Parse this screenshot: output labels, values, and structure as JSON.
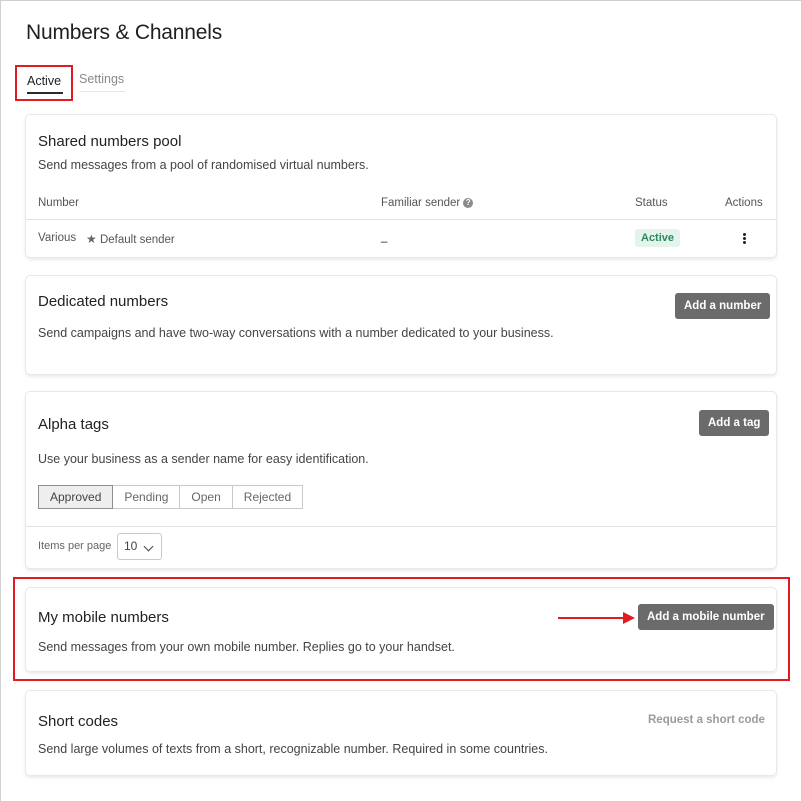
{
  "page": {
    "title": "Numbers & Channels"
  },
  "tabs": [
    {
      "label": "Active",
      "active": true
    },
    {
      "label": "Settings",
      "active": false
    }
  ],
  "shared_pool": {
    "title": "Shared numbers pool",
    "description": "Send messages from a pool of randomised virtual numbers.",
    "columns": [
      "Number",
      "Familiar sender",
      "Status",
      "Actions"
    ],
    "row": {
      "number": "Various",
      "default_sender": "Default sender",
      "familiar_sender": "_",
      "status": "Active"
    }
  },
  "dedicated": {
    "title": "Dedicated numbers",
    "description": "Send campaigns and have two-way conversations with a number dedicated to your business.",
    "button": "Add a number"
  },
  "alpha_tags": {
    "title": "Alpha tags",
    "description": "Use your business as a sender name for easy identification.",
    "button": "Add a tag",
    "filters": [
      "Approved",
      "Pending",
      "Open",
      "Rejected"
    ],
    "selected_filter": "Approved",
    "items_per_page_label": "Items per page",
    "items_per_page": "10"
  },
  "mobile": {
    "title": "My mobile numbers",
    "description": "Send messages from your own mobile number. Replies go to your handset.",
    "button": "Add a mobile number"
  },
  "short_codes": {
    "title": "Short codes",
    "description": "Send large volumes of texts from a short, recognizable number. Required in some countries.",
    "link": "Request a short code"
  },
  "colors": {
    "highlight": "#e01b22",
    "button_bg": "#6b6b6b",
    "status_bg": "#e4f4ec",
    "status_text": "#2b8a5a"
  }
}
